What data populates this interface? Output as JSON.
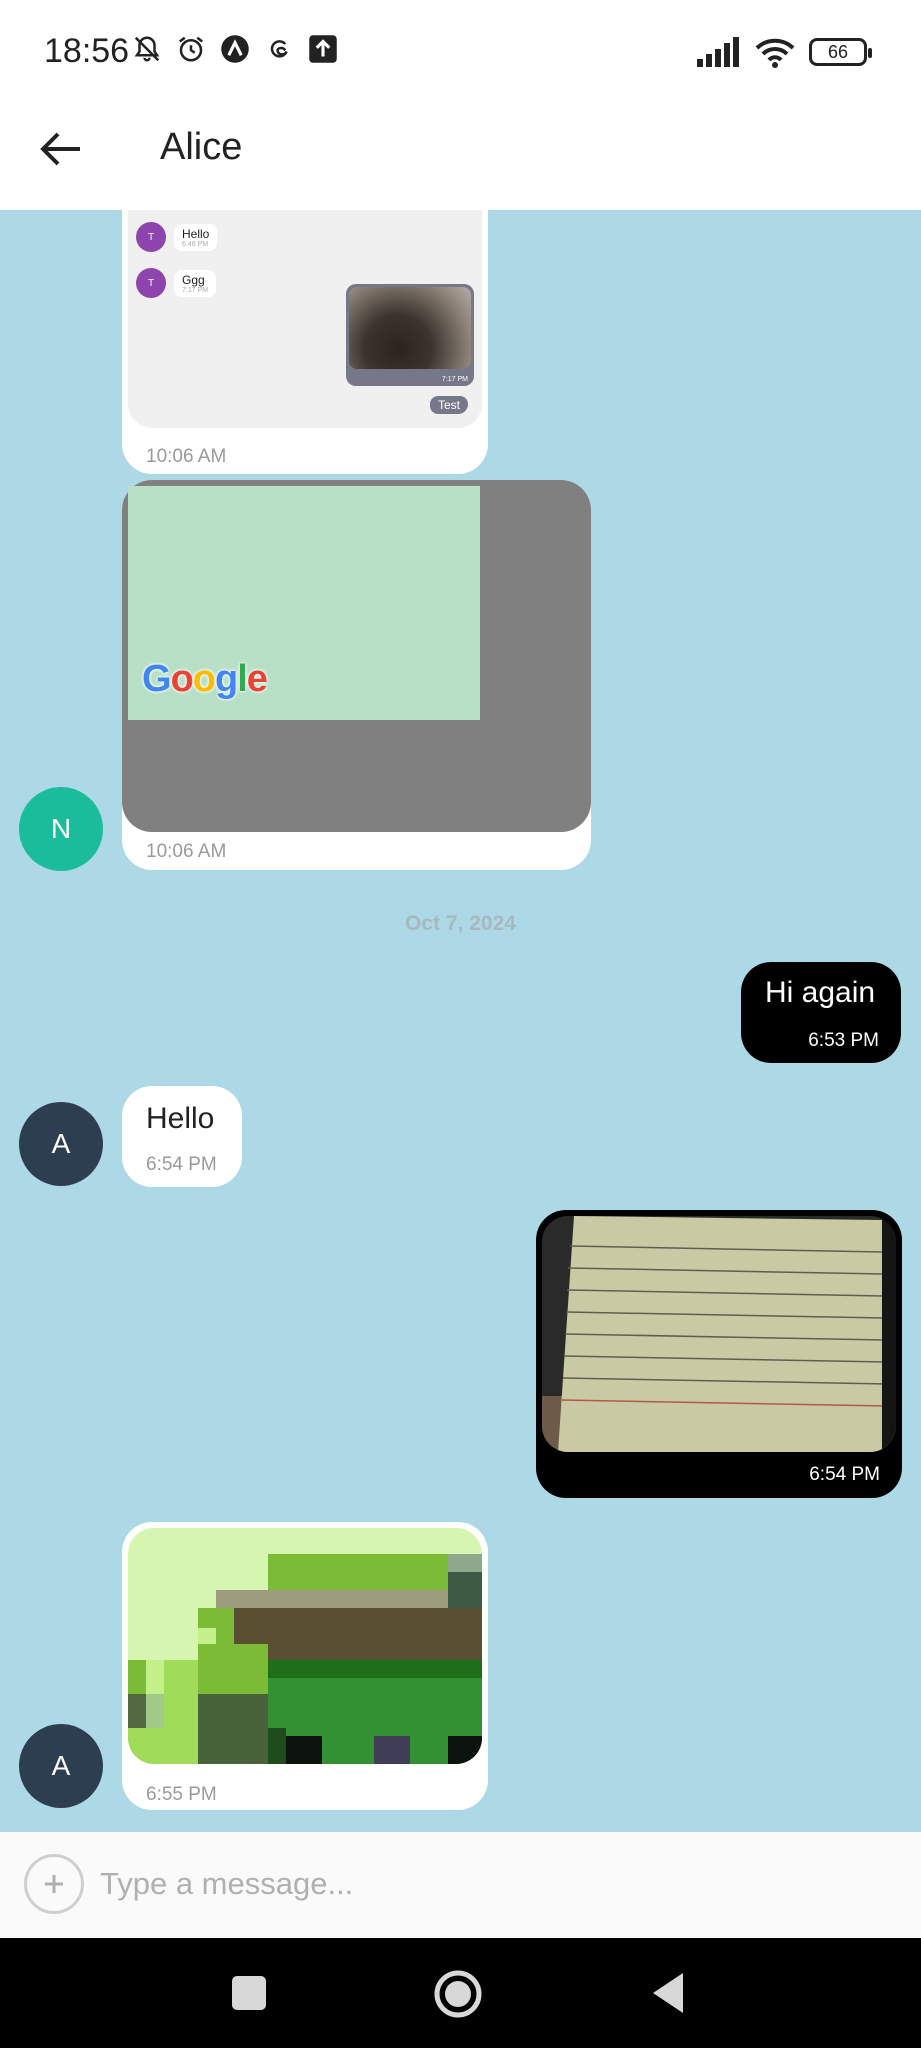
{
  "status": {
    "time": "18:56",
    "battery": "66"
  },
  "header": {
    "title": "Alice"
  },
  "messages": {
    "screenshot_time": "10:06 AM",
    "preview": {
      "rows": [
        {
          "initial": "T",
          "text": "Hello",
          "time": "6:46 PM"
        },
        {
          "initial": "T",
          "text": "Ggg",
          "time": "7:17 PM"
        }
      ],
      "photo_time": "7:17 PM",
      "test_label": "Test"
    },
    "map_time": "10:06 AM",
    "map_logo": "Google",
    "avatar_n": "N",
    "date_separator": "Oct 7, 2024",
    "hi_again": {
      "text": "Hi again",
      "time": "6:53 PM"
    },
    "hello": {
      "text": "Hello",
      "time": "6:54 PM"
    },
    "avatar_a1": "A",
    "photo_out_time": "6:54 PM",
    "pixel_time": "6:55 PM",
    "avatar_a2": "A"
  },
  "composer": {
    "placeholder": "Type a message..."
  },
  "colors": {
    "chat_bg": "#add8e6",
    "outgoing": "#000000",
    "avatar_n": "#1abc9c",
    "avatar_a": "#2c3e50"
  }
}
